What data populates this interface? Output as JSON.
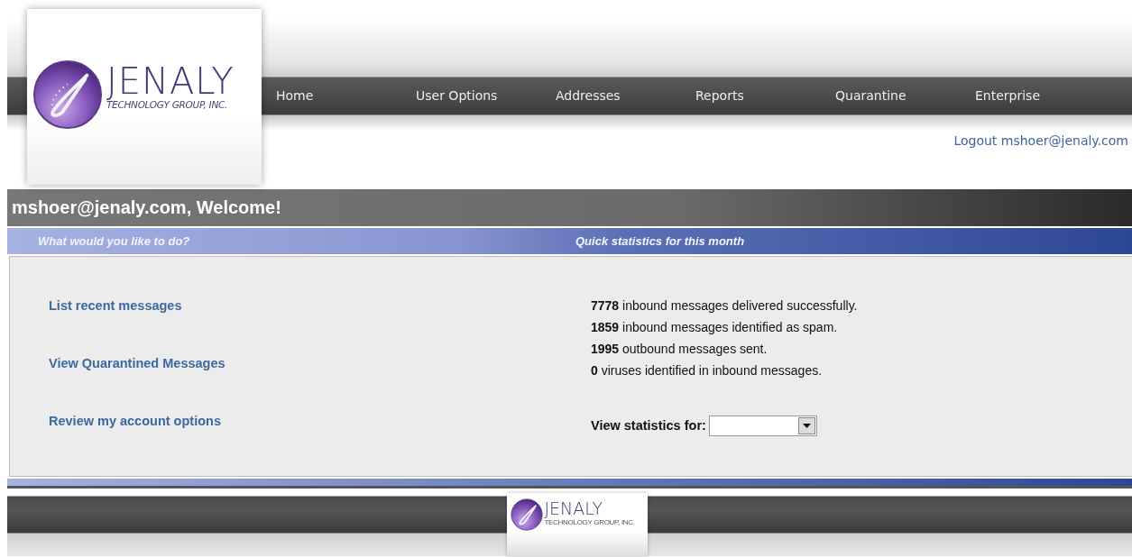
{
  "logo": {
    "name": "JENALY",
    "tagline": "TECHNOLOGY GROUP, INC."
  },
  "nav": [
    "Home",
    "User Options",
    "Addresses",
    "Reports",
    "Quarantine",
    "Enterprise"
  ],
  "logout": "Logout mshoer@jenaly.com",
  "welcome": "mshoer@jenaly.com, Welcome!",
  "actions": {
    "heading": "What would you like to do?",
    "links": [
      "List recent messages",
      "View Quarantined Messages",
      "Review my account options"
    ]
  },
  "stats": {
    "heading": "Quick statistics for this month",
    "lines": [
      "**7778** inbound messages delivered successfully.",
      "**1859** inbound messages identified as spam.",
      "**1995** outbound messages sent.",
      "**0** viruses identified in inbound messages."
    ],
    "period_label": "View statistics for:"
  },
  "footer_logo": {
    "name": "JENALY",
    "tagline": "TECHNOLOGY GROUP, INC."
  }
}
